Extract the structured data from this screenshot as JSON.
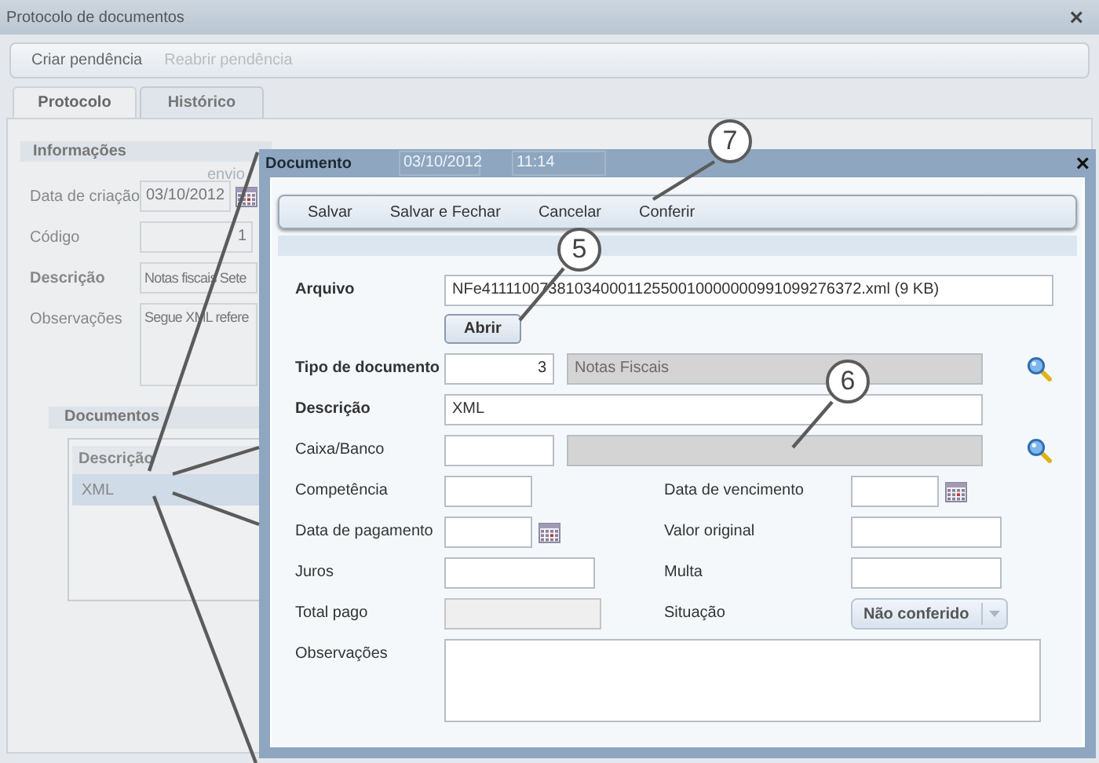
{
  "window": {
    "title": "Protocolo de documentos",
    "close": "×"
  },
  "toolbar": [
    {
      "label": "Criar pendência",
      "disabled": false
    },
    {
      "label": "Reabrir pendência",
      "disabled": true
    }
  ],
  "tabs": [
    {
      "label": "Protocolo",
      "selected": true
    },
    {
      "label": "Histórico",
      "selected": false
    }
  ],
  "info_section": {
    "title": "Informações",
    "fields": [
      {
        "kind": "date",
        "label": "Data de criação",
        "value": "03/10/2012",
        "required": false
      },
      {
        "kind": "number",
        "label": "Código",
        "value": "1",
        "required": false
      },
      {
        "kind": "text",
        "label": "Descrição",
        "value": "Notas fiscais Sete",
        "required": true
      },
      {
        "kind": "textarea",
        "label": "Observações",
        "value": "Segue XML refere",
        "required": false
      }
    ],
    "send": {
      "label": "envio",
      "date": "03/10/2012",
      "time": "11:14"
    }
  },
  "documents_section": {
    "title": "Documentos",
    "columns": [
      "Descrição"
    ],
    "rows": [
      {
        "cells": [
          "XML"
        ],
        "selected": true
      }
    ]
  },
  "dialog": {
    "title": "Documento",
    "close": "×",
    "toolbar": [
      "Salvar",
      "Salvar e Fechar",
      "Cancelar",
      "Conferir"
    ],
    "file": {
      "label": "Arquivo",
      "value": "NFe41111007381034000112550010000000991099276372.xml (9 KB)",
      "button": "Abrir"
    },
    "rows": [
      {
        "kind": "lookup",
        "label": "Tipo de documento",
        "required": true,
        "code": "3",
        "name": "Notas Fiscais"
      },
      {
        "kind": "text",
        "label": "Descrição",
        "required": true,
        "value": "XML"
      },
      {
        "kind": "lookup",
        "label": "Caixa/Banco",
        "required": false
      },
      {
        "kind": "pair",
        "left": {
          "kind": "short",
          "label": "Competência"
        },
        "right": {
          "kind": "date",
          "label": "Data de vencimento"
        }
      },
      {
        "kind": "pair",
        "left": {
          "kind": "date",
          "label": "Data de pagamento"
        },
        "right": {
          "kind": "wide",
          "label": "Valor original"
        }
      },
      {
        "kind": "pair",
        "left": {
          "kind": "wide",
          "label": "Juros"
        },
        "right": {
          "kind": "wide",
          "label": "Multa"
        }
      },
      {
        "kind": "pair",
        "left": {
          "kind": "readonly",
          "label": "Total pago"
        },
        "right": {
          "kind": "dropdown",
          "label": "Situação",
          "value": "Não conferido"
        }
      },
      {
        "kind": "textarea",
        "label": "Observações",
        "required": false
      }
    ]
  },
  "callouts": [
    {
      "number": "7"
    },
    {
      "number": "5"
    },
    {
      "number": "6"
    }
  ]
}
